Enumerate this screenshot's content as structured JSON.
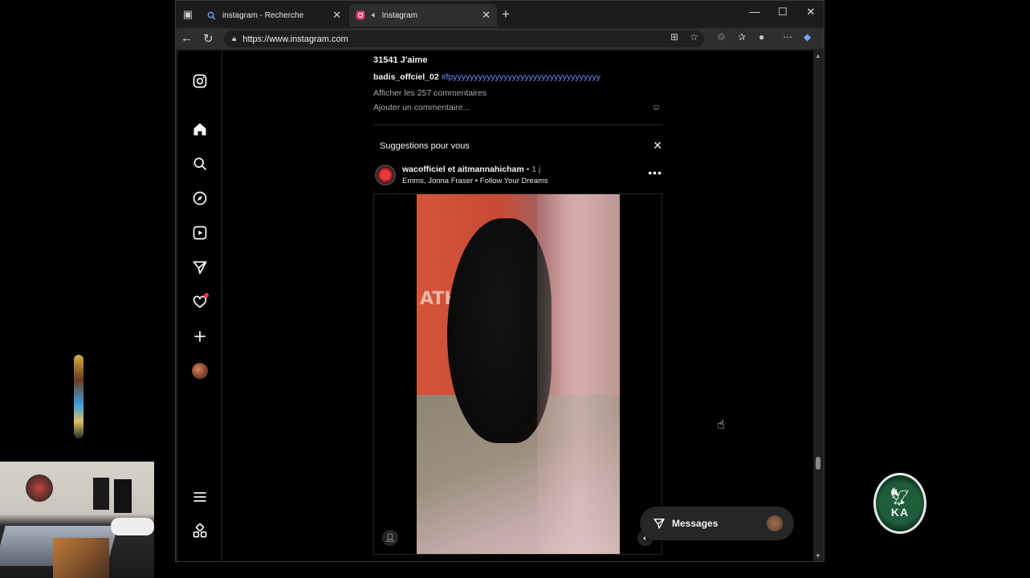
{
  "browser": {
    "tabs": [
      {
        "label": "instagram - Recherche",
        "favicon": "search-icon"
      },
      {
        "label": "Instagram",
        "favicon": "instagram-icon",
        "active": true
      }
    ],
    "url": "https://www.instagram.com"
  },
  "feed": {
    "likes": "31541 J'aime",
    "caption_user": "badis_offciel_02",
    "caption_hashtag": "#fpyyyyyyyyyyyyyyyyyyyyyyyyyyyyyyyyyyy",
    "view_comments": "Afficher les 257 commentaires",
    "add_comment_placeholder": "Ajouter un commentaire..."
  },
  "suggestions": {
    "title": "Suggestions pour vous",
    "post": {
      "users": "wacofficiel et aitmannahicham",
      "time": " • 1 j",
      "audio": "Emms, Jonna Fraser • Follow Your Dreams",
      "overlay_text": "ATH"
    }
  },
  "messages": {
    "label": "Messages"
  },
  "colors": {
    "background": "#000000",
    "hashtag": "#6d8cff",
    "notification": "#ff3040"
  }
}
